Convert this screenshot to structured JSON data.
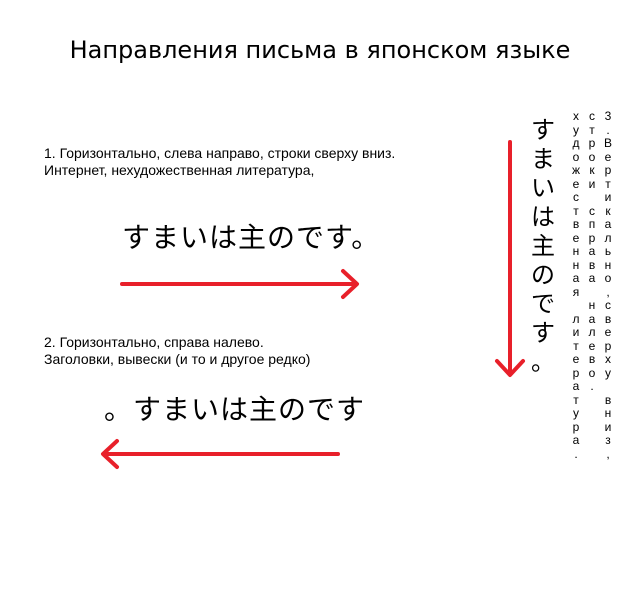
{
  "title": "Направления письма  в японском языке",
  "sections": {
    "horizontal_ltr": {
      "caption_line1": "1. Горизонтально, слева направо, строки сверху вниз.",
      "caption_line2": "Интернет, нехудожественная литература,",
      "sample": "すまいは主のです。"
    },
    "horizontal_rtl": {
      "caption_line1": "2. Горизонтально, справа налево.",
      "caption_line2": "Заголовки, вывески (и то и другое редко)",
      "sample": "。すまいは主のです"
    },
    "vertical": {
      "sample": "すまいは主のです。",
      "caption_col1": "3.Вертикально,сверху вниз,",
      "caption_col2": "строки справа налево.",
      "caption_col3": "художественная литература."
    }
  },
  "colors": {
    "arrow": "#e8202a",
    "text": "#000000"
  }
}
